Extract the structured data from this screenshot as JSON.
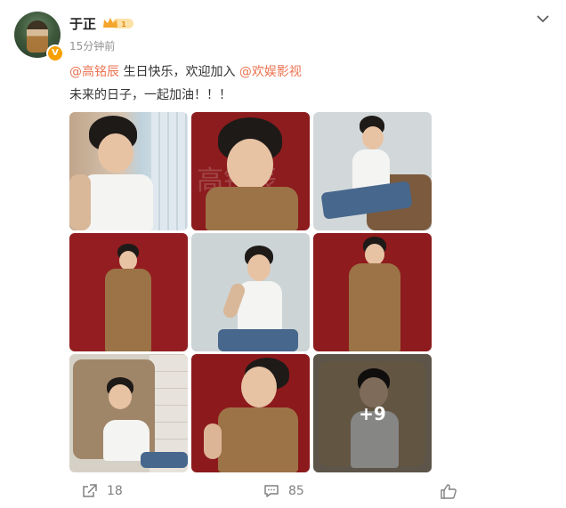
{
  "post": {
    "user": {
      "name": "于正",
      "level_badge": "1",
      "verified_icon": "v-badge-icon",
      "avatar_icon": "avatar"
    },
    "time": "15分钟前",
    "text": {
      "mention1": "@高铭辰",
      "middle": " 生日快乐，欢迎加入 ",
      "mention2": "@欢娱影视",
      "line2": "未来的日子，一起加油！！！"
    },
    "images": {
      "count_more": "+9",
      "tiles": [
        {
          "scene": "window-white-tank"
        },
        {
          "scene": "red-coat-closeup"
        },
        {
          "scene": "chair-white-tank-jeans"
        },
        {
          "scene": "red-long-coat"
        },
        {
          "scene": "grey-white-tank"
        },
        {
          "scene": "red-long-coat-2"
        },
        {
          "scene": "armchair-lounging"
        },
        {
          "scene": "red-profile-coat"
        },
        {
          "scene": "armchair-dark"
        }
      ],
      "watermark_text": "高铭辰"
    },
    "footer": {
      "share_count": "18",
      "comment_count": "85",
      "like_icon": "thumb-up-icon"
    },
    "colors": {
      "mention": "#eb7350",
      "red_bg": "#8e1b1d",
      "gray_bg": "#cdd3d4"
    }
  }
}
